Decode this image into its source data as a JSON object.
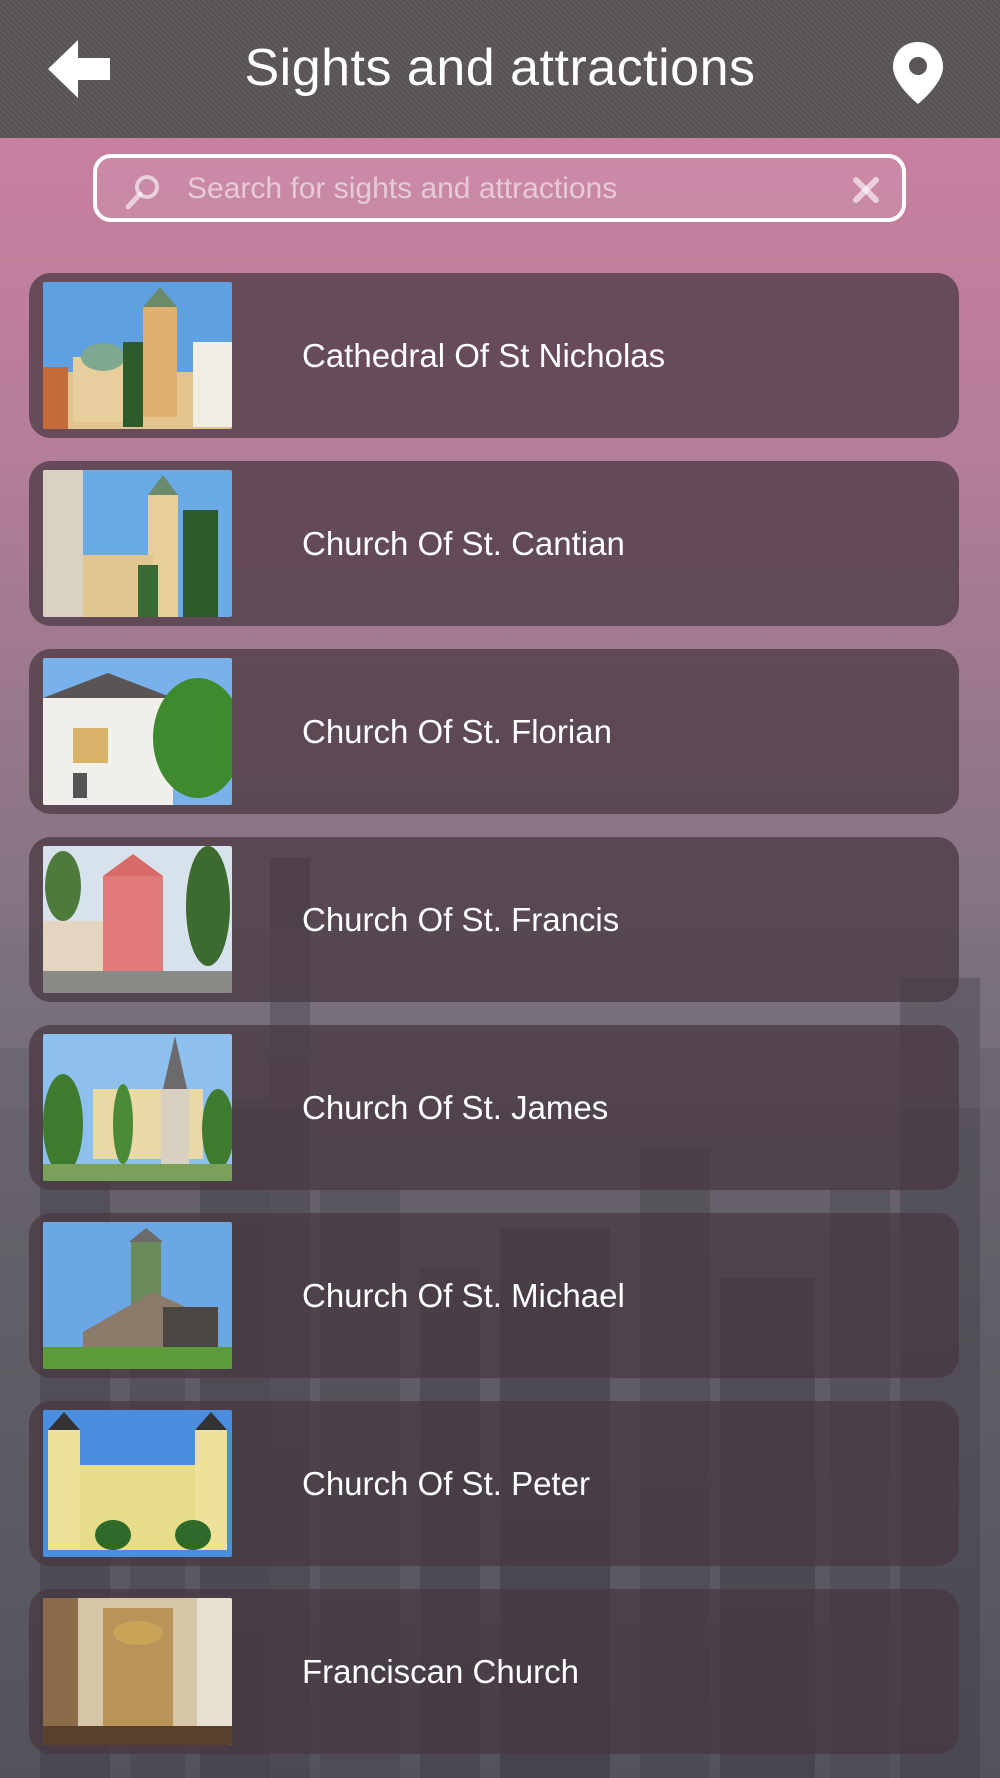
{
  "header": {
    "title": "Sights and attractions",
    "back_icon": "back-arrow-icon",
    "map_icon": "map-pin-icon"
  },
  "search": {
    "placeholder": "Search for sights and attractions",
    "value": "",
    "search_icon": "magnifier-icon",
    "clear_icon": "close-icon"
  },
  "list": {
    "items": [
      {
        "label": "Cathedral Of St Nicholas",
        "thumbnail": "photo-cathedral-st-nicholas"
      },
      {
        "label": "Church Of St. Cantian",
        "thumbnail": "photo-church-st-cantian"
      },
      {
        "label": "Church Of St. Florian",
        "thumbnail": "photo-church-st-florian"
      },
      {
        "label": "Church Of St. Francis",
        "thumbnail": "photo-church-st-francis"
      },
      {
        "label": "Church Of St. James",
        "thumbnail": "photo-church-st-james"
      },
      {
        "label": "Church Of St. Michael",
        "thumbnail": "photo-church-st-michael"
      },
      {
        "label": "Church Of St. Peter",
        "thumbnail": "photo-church-st-peter"
      },
      {
        "label": "Franciscan Church",
        "thumbnail": "photo-franciscan-church"
      }
    ]
  },
  "colors": {
    "header_bg": "#5b5557",
    "row_bg": "#463741",
    "text": "#ffffff",
    "background_tint": "#c98aa6"
  }
}
